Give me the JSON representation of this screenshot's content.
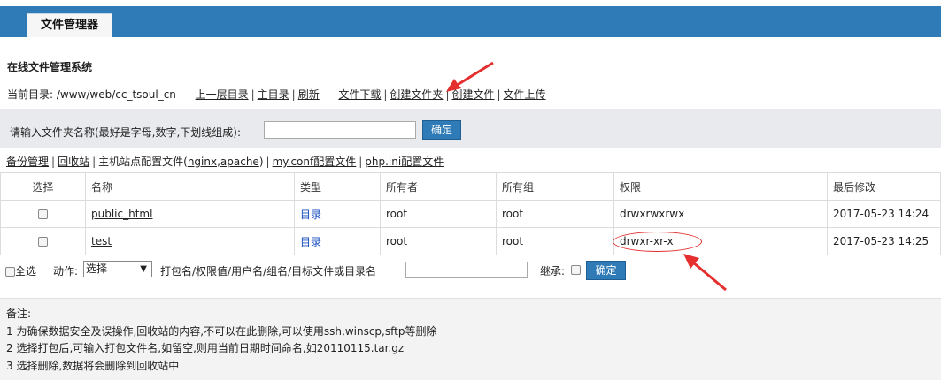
{
  "header": {
    "tab_label": "文件管理器"
  },
  "system_title": "在线文件管理系统",
  "path_bar": {
    "current_dir_label": "当前目录:",
    "current_dir": "/www/web/cc_tsoul_cn",
    "links": [
      "上一层目录",
      "主目录",
      "刷新",
      "文件下载",
      "创建文件夹",
      "创建文件",
      "文件上传"
    ]
  },
  "create_folder": {
    "prompt": "请输入文件夹名称(最好是字母,数字,下划线组成):",
    "input_value": "",
    "confirm": "确定"
  },
  "quick_links": [
    "备份管理",
    "回收站",
    "主机站点配置文件(nginx,apache)",
    "my.conf配置文件",
    "php.ini配置文件"
  ],
  "quick_link_host_prefix": "主机站点配置文件(",
  "quick_link_host_nginx": "nginx",
  "quick_link_host_apache": "apache",
  "quick_link_host_suffix": ")",
  "table": {
    "headers": [
      "选择",
      "名称",
      "类型",
      "所有者",
      "所有组",
      "权限",
      "最后修改"
    ],
    "rows": [
      {
        "name": "public_html",
        "type": "目录",
        "owner": "root",
        "group": "root",
        "perm": "drwxrwxrwx",
        "modified": "2017-05-23 14:24"
      },
      {
        "name": "test",
        "type": "目录",
        "owner": "root",
        "group": "root",
        "perm": "drwxr-xr-x",
        "modified": "2017-05-23 14:25"
      }
    ]
  },
  "action_bar": {
    "select_all": "全选",
    "action_label": "动作:",
    "action_value": "选择",
    "params_label": "打包名/权限值/用户名/组名/目标文件或目录名",
    "params_value": "",
    "inherit_label": "继承:",
    "confirm": "确定"
  },
  "notes": {
    "title": "备注:",
    "lines": [
      "1 为确保数据安全及误操作,回收站的内容,不可以在此删除,可以使用ssh,winscp,sftp等删除",
      "2 选择打包后,可输入打包文件名,如留空,则用当前日期时间命名,如20110115.tar.gz",
      "3 选择删除,数据将会删除到回收站中"
    ]
  },
  "colors": {
    "accent": "#2f7bb7",
    "annotation": "#e52f2f",
    "type_link": "#1a4fbf"
  }
}
